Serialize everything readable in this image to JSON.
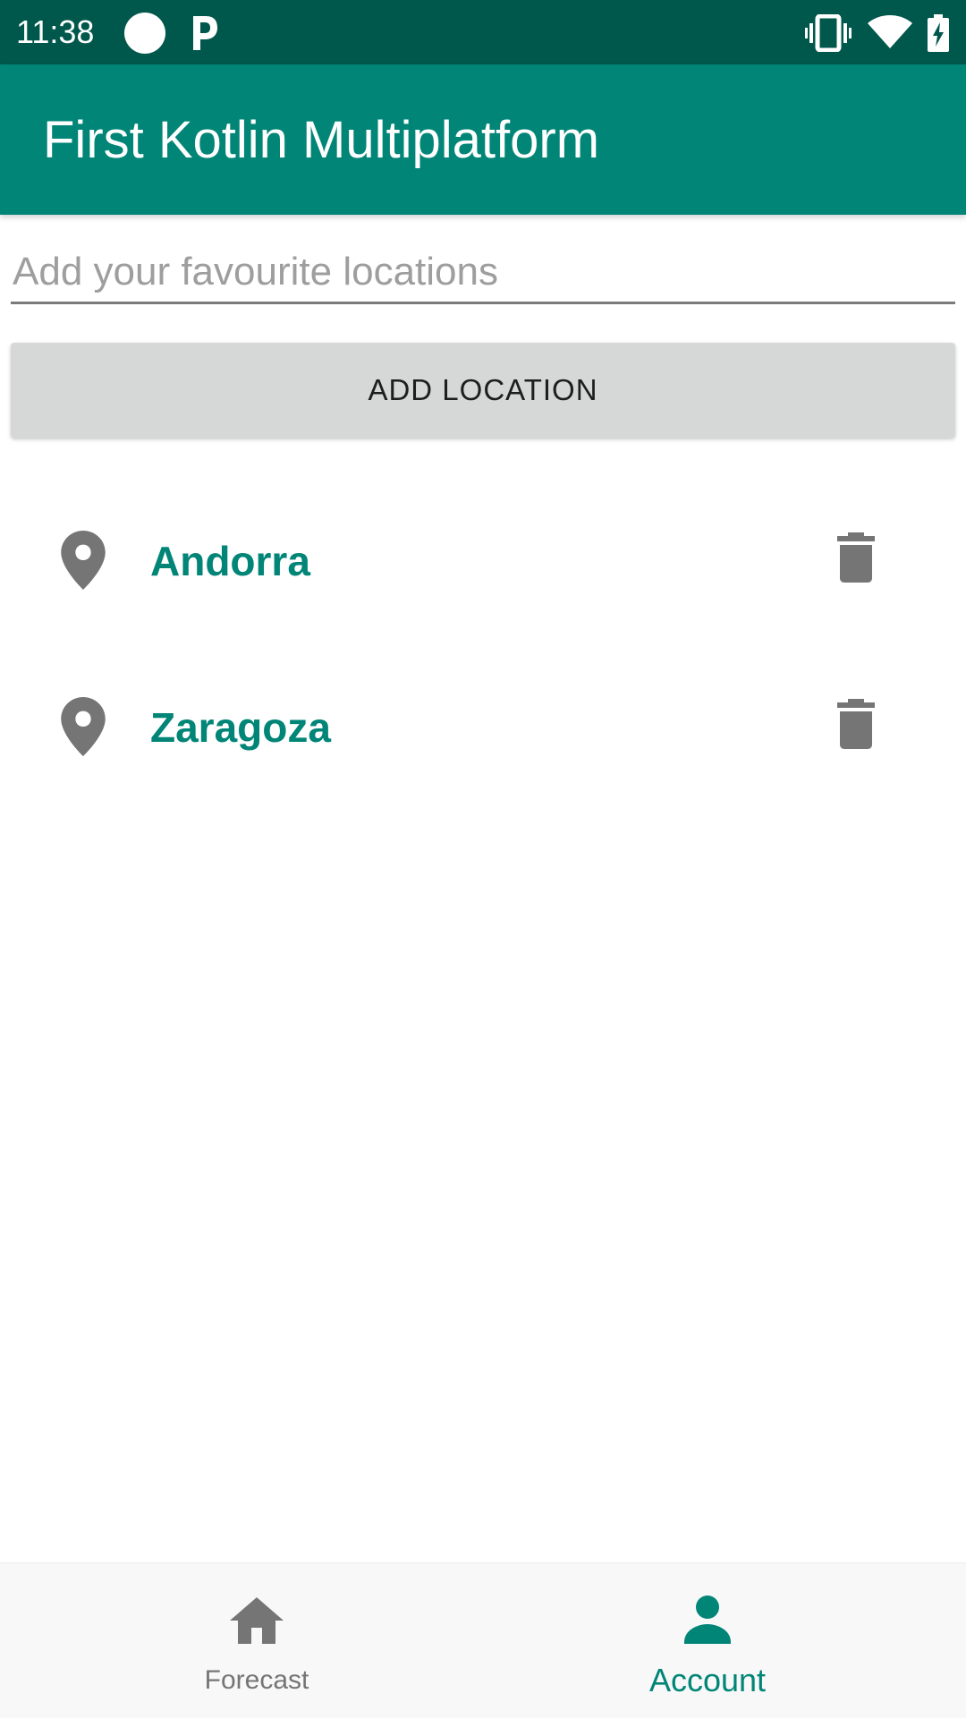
{
  "status_bar": {
    "time": "11:38"
  },
  "app_bar": {
    "title": "First Kotlin Multiplatform"
  },
  "location_input": {
    "placeholder": "Add your favourite locations",
    "value": ""
  },
  "add_button": {
    "label": "ADD LOCATION"
  },
  "locations": [
    {
      "name": "Andorra",
      "icon": "pin-icon",
      "action_icon": "trash-icon"
    },
    {
      "name": "Zaragoza",
      "icon": "pin-icon",
      "action_icon": "trash-icon"
    }
  ],
  "bottom_nav": {
    "items": [
      {
        "label": "Forecast",
        "icon": "home-icon",
        "selected": false
      },
      {
        "label": "Account",
        "icon": "person-icon",
        "selected": true
      }
    ]
  },
  "colors": {
    "status_bar": "#00574b",
    "primary": "#008577",
    "icon_gray": "#757575",
    "button_bg": "#d6d7d7"
  }
}
